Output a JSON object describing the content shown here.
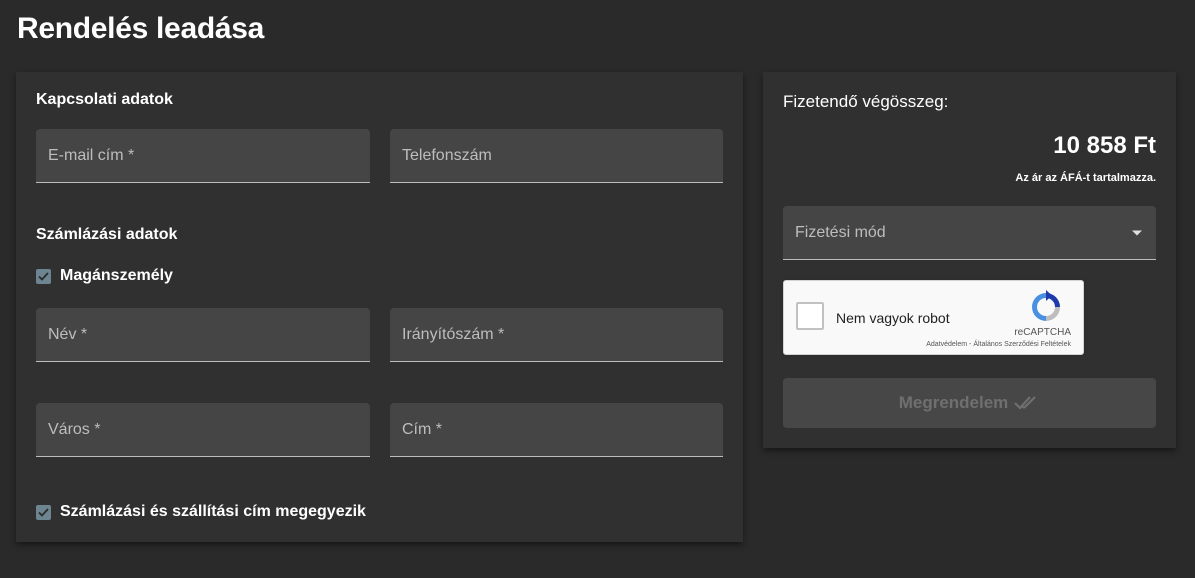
{
  "page": {
    "title": "Rendelés leadása"
  },
  "contact": {
    "title": "Kapcsolati adatok",
    "email_label": "E-mail cím *",
    "phone_label": "Telefonszám"
  },
  "billing": {
    "title": "Számlázási adatok",
    "private_person_label": "Magánszemély",
    "private_person_checked": true,
    "name_label": "Név *",
    "zip_label": "Irányítószám *",
    "city_label": "Város *",
    "address_label": "Cím *",
    "same_address_label": "Számlázási és szállítási cím megegyezik",
    "same_address_checked": true
  },
  "summary": {
    "total_label": "Fizetendő végösszeg:",
    "total_amount": "10 858 Ft",
    "vat_note": "Az ár az ÁFÁ-t tartalmazza.",
    "payment_method_label": "Fizetési mód",
    "submit_label": "Megrendelem"
  },
  "recaptcha": {
    "label": "Nem vagyok robot",
    "brand": "reCAPTCHA",
    "links": "Adatvédelem - Általános Szerződési Feltételek"
  },
  "icons": {
    "checkbox": "check-icon",
    "select": "dropdown-arrow-icon",
    "submit": "double-check-icon",
    "recaptcha": "recaptcha-logo-icon"
  },
  "colors": {
    "background": "#2a2a2a",
    "card": "#303030",
    "field": "#454545",
    "checkbox": "#6c8591",
    "button_disabled": "#474747"
  }
}
